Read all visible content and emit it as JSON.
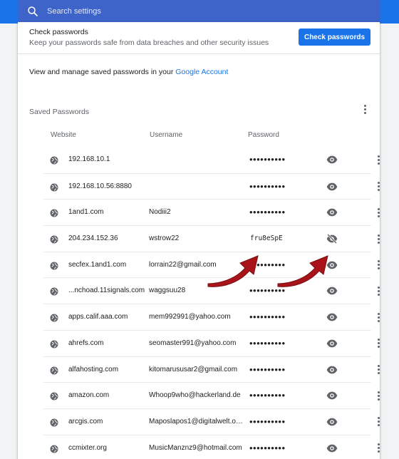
{
  "search": {
    "placeholder": "Search settings"
  },
  "check": {
    "title": "Check passwords",
    "description": "Keep your passwords safe from data breaches and other security issues",
    "button": "Check passwords"
  },
  "manage": {
    "prefix": "View and manage saved passwords in your ",
    "link": "Google Account"
  },
  "saved": {
    "title": "Saved Passwords",
    "columns": {
      "website": "Website",
      "username": "Username",
      "password": "Password"
    },
    "rows": [
      {
        "site": "192.168.10.1",
        "user": "",
        "password": "••••••••••",
        "revealed": false
      },
      {
        "site": "192.168.10.56:8880",
        "user": "",
        "password": "••••••••••",
        "revealed": false
      },
      {
        "site": "1and1.com",
        "user": "Nodiii2",
        "password": "••••••••••",
        "revealed": false
      },
      {
        "site": "204.234.152.36",
        "user": "wstrow22",
        "password": "fru8eSpE",
        "revealed": true
      },
      {
        "site": "secfex.1and1.com",
        "user": "lorrain22@gmail.com",
        "password": "••••••••••",
        "revealed": false
      },
      {
        "site": "...nchoad.11signals.com",
        "user": "waggsuu28",
        "password": "••••••••••",
        "revealed": false
      },
      {
        "site": "apps.calif.aaa.com",
        "user": "mem992991@yahoo.com",
        "password": "••••••••••",
        "revealed": false
      },
      {
        "site": "ahrefs.com",
        "user": "seomaster991@yahoo.com",
        "password": "••••••••••",
        "revealed": false
      },
      {
        "site": "alfahosting.com",
        "user": "kitomarususar2@gmail.com",
        "password": "••••••••••",
        "revealed": false
      },
      {
        "site": "amazon.com",
        "user": "Whoop9who@hackerland.de",
        "password": "••••••••••",
        "revealed": false
      },
      {
        "site": "arcgis.com",
        "user": "Maposlapos1@digitalwelt.or...",
        "password": "••••••••••",
        "revealed": false
      },
      {
        "site": "ccmixter.org",
        "user": "MusicManznz9@hotmail.com",
        "password": "••••••••••",
        "revealed": false
      }
    ]
  },
  "icons": {
    "search": "search-icon",
    "globe": "globe-icon",
    "eye": "eye-icon",
    "eye_off": "eye-off-icon",
    "more": "more-vert-icon",
    "annotation": "red-arrow"
  },
  "colors": {
    "accent": "#1a73e8",
    "header": "#1a73e8",
    "annotation_arrow": "#a8141a"
  }
}
